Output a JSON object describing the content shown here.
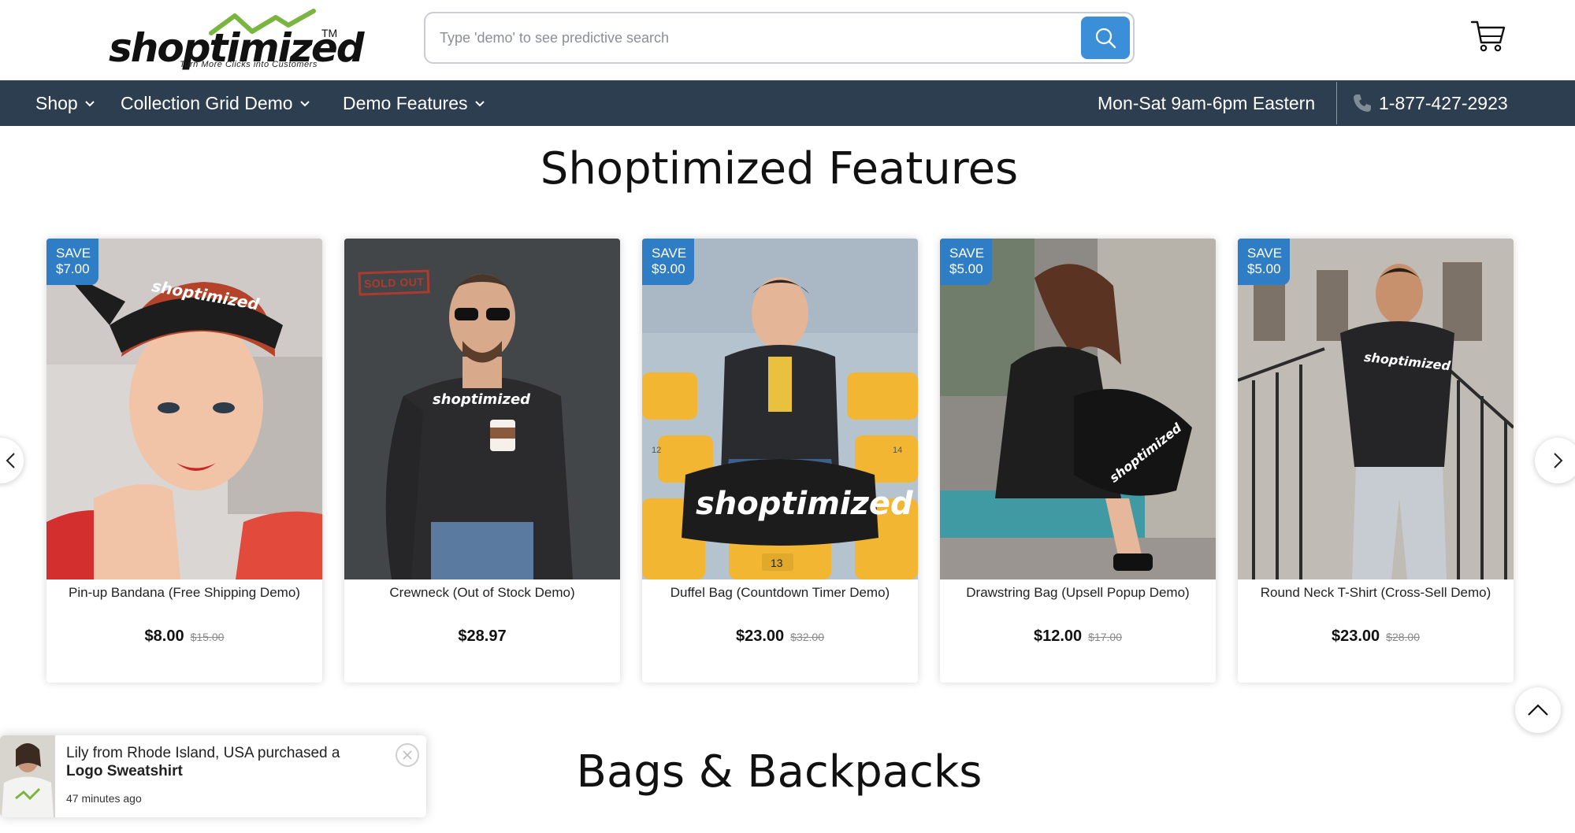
{
  "brand": {
    "name": "shoptimized",
    "tm": "TM",
    "tagline": "Turn More Clicks into Customers"
  },
  "search": {
    "placeholder": "Type 'demo' to see predictive search",
    "value": ""
  },
  "nav": {
    "items": [
      {
        "label": "Shop"
      },
      {
        "label": "Collection Grid Demo"
      },
      {
        "label": "Demo Features"
      }
    ],
    "hours": "Mon-Sat 9am-6pm Eastern",
    "phone": "1-877-427-2923"
  },
  "sections": {
    "features_title": "Shoptimized Features",
    "bags_title": "Bags & Backpacks"
  },
  "products": [
    {
      "title": "Pin-up Bandana (Free Shipping Demo)",
      "price": "$8.00",
      "compare": "$15.00",
      "save_label": "SAVE",
      "save_amount": "$7.00"
    },
    {
      "title": "Crewneck (Out of Stock Demo)",
      "price": "$28.97",
      "compare": "",
      "badge": "SOLD OUT"
    },
    {
      "title": "Duffel Bag (Countdown Timer Demo)",
      "price": "$23.00",
      "compare": "$32.00",
      "save_label": "SAVE",
      "save_amount": "$9.00"
    },
    {
      "title": "Drawstring Bag (Upsell Popup Demo)",
      "price": "$12.00",
      "compare": "$17.00",
      "save_label": "SAVE",
      "save_amount": "$5.00"
    },
    {
      "title": "Round Neck T-Shirt (Cross-Sell Demo)",
      "price": "$23.00",
      "compare": "$28.00",
      "save_label": "SAVE",
      "save_amount": "$5.00"
    }
  ],
  "product_image_text": {
    "print": "shoptimized",
    "seat_1": "12",
    "seat_2": "14",
    "seat_3": "13"
  },
  "popup": {
    "message": "Lily from Rhode Island, USA purchased a",
    "product": "Logo Sweatshirt",
    "time": "47 minutes ago"
  },
  "colors": {
    "nav_bg": "#2d3e50",
    "accent": "#3b8fd9",
    "save_badge": "#2f7dc4",
    "logo_green": "#7ab540"
  },
  "icons": [
    "search-icon",
    "cart-icon",
    "chevron-down-icon",
    "phone-icon",
    "chevron-left-icon",
    "chevron-right-icon",
    "chevron-up-icon",
    "close-icon"
  ]
}
